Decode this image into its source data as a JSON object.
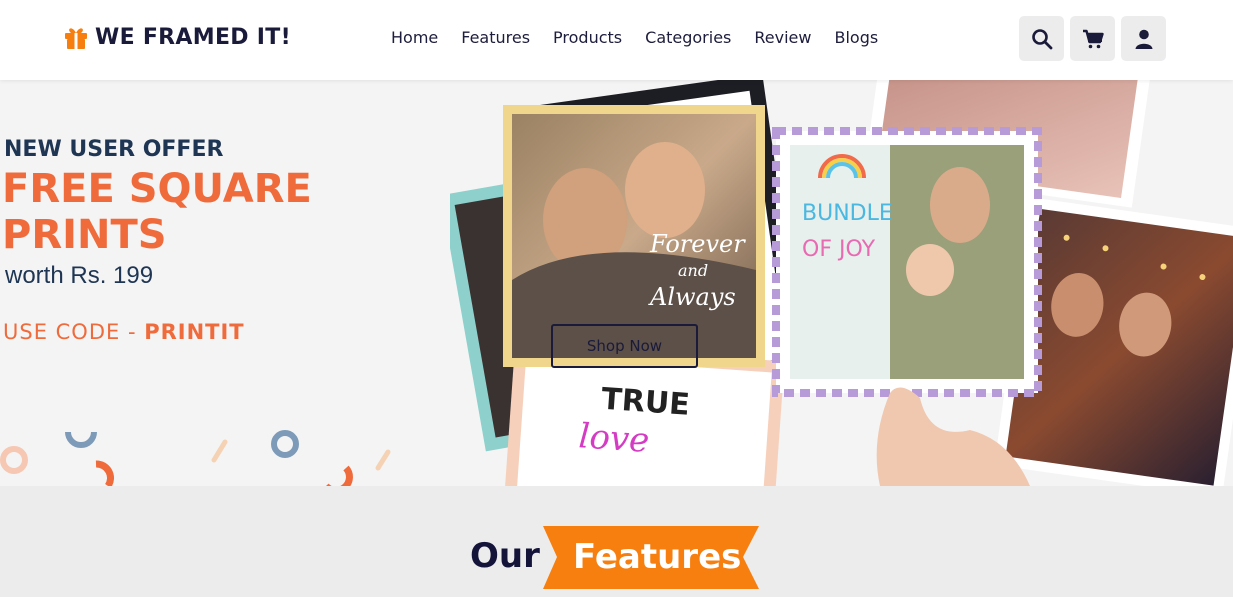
{
  "brand": {
    "name": "WE FRAMED IT!",
    "icon": "gift-icon"
  },
  "nav": {
    "items": [
      {
        "label": "Home"
      },
      {
        "label": "Features"
      },
      {
        "label": "Products"
      },
      {
        "label": "Categories"
      },
      {
        "label": "Review"
      },
      {
        "label": "Blogs"
      }
    ]
  },
  "header_icons": [
    "search-icon",
    "cart-icon",
    "user-icon"
  ],
  "hero": {
    "offer_small": "NEW USER OFFER",
    "offer_big": "FREE SQUARE PRINTS",
    "worth": "worth Rs. 199",
    "code_prefix": "USE CODE - ",
    "code": "PRINTIT",
    "shop_button": "Shop Now",
    "photo_text": {
      "forever": "Forever",
      "and": "and",
      "always": "Always",
      "bundle": "BUNDLE",
      "of_joy": "OF JOY",
      "true": "TRUE",
      "love": "love"
    }
  },
  "features": {
    "word1": "Our",
    "word2": "Features"
  },
  "colors": {
    "accent": "#ef6b3c",
    "navy": "#1e3553",
    "tag": "#f77f10"
  }
}
